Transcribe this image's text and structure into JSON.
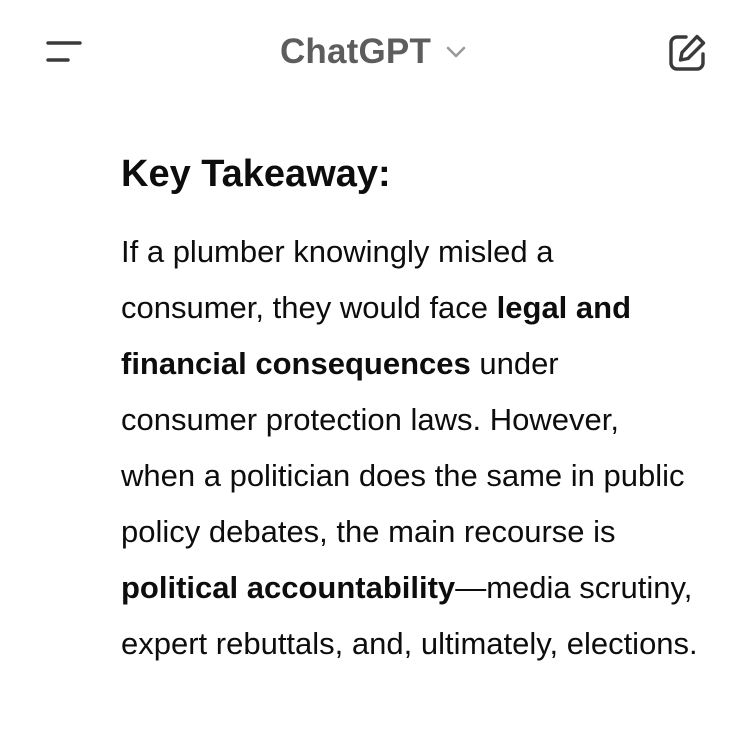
{
  "header": {
    "title": "ChatGPT",
    "menu_icon": "menu-icon",
    "chevron_icon": "chevron-down-icon",
    "new_chat_icon": "new-chat-icon"
  },
  "message": {
    "heading": "Key Takeaway:",
    "paragraph": {
      "s1": "If a plumber knowingly misled a consumer, they would face ",
      "b1": "legal and financial consequences",
      "s2": " under consumer protection laws. However, when a politician does the same in public policy debates, the main recourse is ",
      "b2": "political accountability",
      "s3": "—media scrutiny, expert rebuttals, and, ultimately, elections."
    }
  },
  "colors": {
    "text": "#0d0d0d",
    "title": "#5d5d5d",
    "icon": "#3a3a3a",
    "background": "#ffffff"
  }
}
